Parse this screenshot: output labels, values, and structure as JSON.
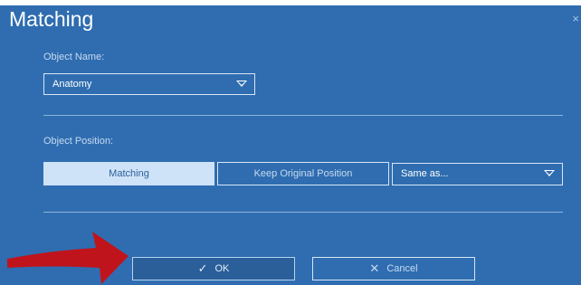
{
  "dialog": {
    "title": "Matching",
    "close_glyph": "×"
  },
  "object_name": {
    "label": "Object Name:",
    "selected": "Anatomy"
  },
  "object_position": {
    "label": "Object Position:",
    "matching_label": "Matching",
    "keep_original_label": "Keep Original Position",
    "same_as_selected": "Same as..."
  },
  "footer": {
    "ok_label": "OK",
    "ok_icon": "checkmark-icon",
    "ok_glyph": "✓",
    "cancel_label": "Cancel",
    "cancel_icon": "x-icon",
    "cancel_glyph": "✕"
  },
  "colors": {
    "dialog_bg": "#2f6db0",
    "active_button_bg": "#cfe3f8",
    "annotation_arrow": "#c0141c"
  }
}
